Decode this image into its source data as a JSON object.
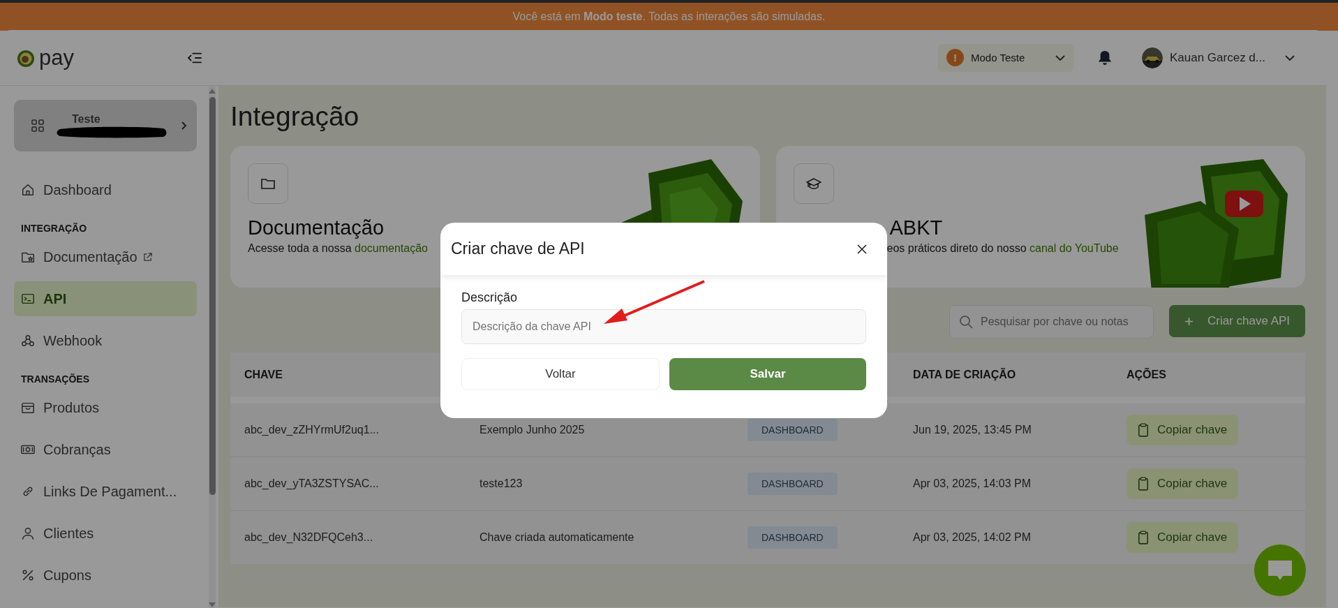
{
  "banner": {
    "text": "Você está em **Modo teste**. Todas as interações são simuladas."
  },
  "header": {
    "logo_text": "pay",
    "mode_select": {
      "badge": "!",
      "label": "Modo Teste"
    },
    "user": {
      "name": "Kauan Garcez d..."
    }
  },
  "sidebar": {
    "account": {
      "name": "Teste"
    },
    "items": [
      {
        "kind": "item",
        "label": "Dashboard",
        "selected": false,
        "external": false
      },
      {
        "kind": "section",
        "label": "INTEGRAÇÃO"
      },
      {
        "kind": "item",
        "label": "Documentação",
        "selected": false,
        "external": true
      },
      {
        "kind": "item",
        "label": "API",
        "selected": true,
        "external": false
      },
      {
        "kind": "item",
        "label": "Webhook",
        "selected": false,
        "external": false
      },
      {
        "kind": "section",
        "label": "TRANSAÇÕES"
      },
      {
        "kind": "item",
        "label": "Produtos",
        "selected": false,
        "external": false
      },
      {
        "kind": "item",
        "label": "Cobranças",
        "selected": false,
        "external": false
      },
      {
        "kind": "item",
        "label": "Links De Pagament...",
        "selected": false,
        "external": false
      },
      {
        "kind": "item",
        "label": "Clientes",
        "selected": false,
        "external": false
      },
      {
        "kind": "item",
        "label": "Cupons",
        "selected": false,
        "external": false
      }
    ]
  },
  "main": {
    "title": "Integração",
    "cards": [
      {
        "title": "Documentação",
        "description": "Acesse toda a nossa ",
        "link": "documentação"
      },
      {
        "title": "ABKT",
        "description": "eos práticos direto do nosso ",
        "link": "canal do YouTube"
      }
    ],
    "search": {
      "placeholder": "Pesquisar por chave ou notas"
    },
    "create_button": {
      "label": "Criar chave API"
    },
    "table": {
      "columns": {
        "column_1": "CHAVE",
        "column_4": "DATA DE CRIAÇÃO",
        "column_5": "AÇÕES"
      },
      "rows": [
        {
          "key": "abc_dev_zZHYrmUf2uq1...",
          "description": "Exemplo Junho 2025",
          "tag": "DASHBOARD",
          "date": "Jun 19, 2025, 13:45 PM",
          "action": "Copiar chave"
        },
        {
          "key": "abc_dev_yTA3ZSTYSAC...",
          "description": "teste123",
          "tag": "DASHBOARD",
          "date": "Apr 03, 2025, 14:03 PM",
          "action": "Copiar chave"
        },
        {
          "key": "abc_dev_N32DFQCeh3...",
          "description": "Chave criada automaticamente",
          "tag": "DASHBOARD",
          "date": "Apr 03, 2025, 14:02 PM",
          "action": "Copiar chave"
        }
      ]
    }
  },
  "modal": {
    "title": "Criar chave de API",
    "field": {
      "label": "Descrição",
      "placeholder": "Descrição da chave API"
    },
    "buttons": [
      {
        "kind": "secondary",
        "label": "Voltar"
      },
      {
        "kind": "primary",
        "label": "Salvar"
      }
    ]
  }
}
